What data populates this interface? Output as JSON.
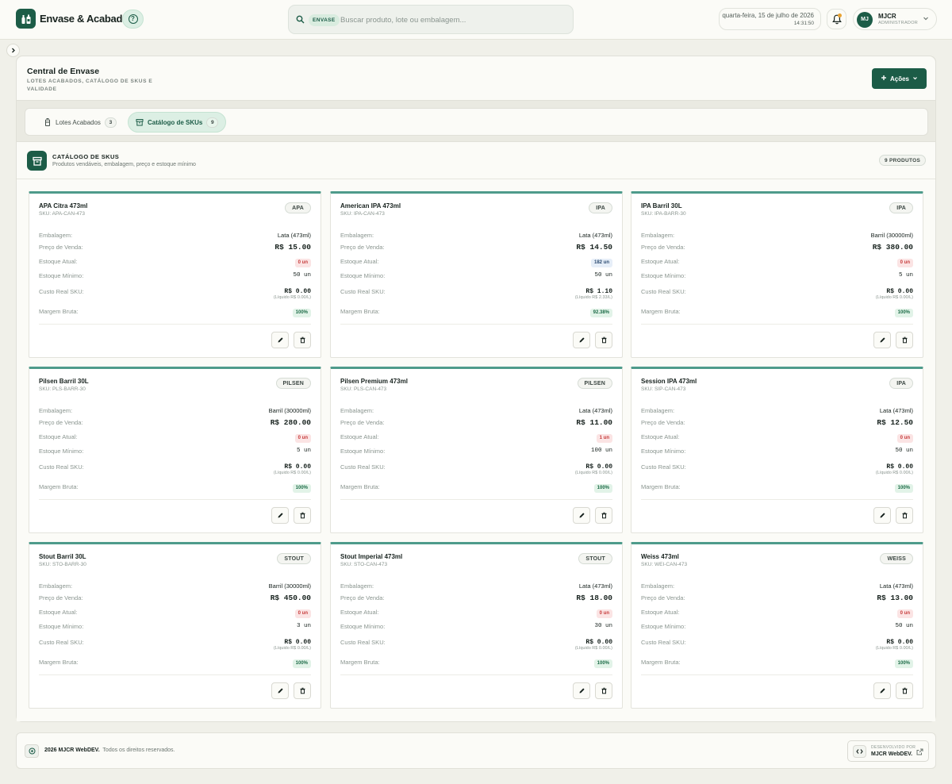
{
  "header": {
    "app_title": "Envase & Acabados",
    "search_chip": "ENVASE",
    "search_placeholder": "Buscar produto, lote ou embalagem...",
    "date": "quarta-feira, 15 de julho de 2026",
    "time": "14:31:50",
    "user_initials": "MJ",
    "user_name": "MJCR",
    "user_role": "ADMINISTRADOR"
  },
  "page": {
    "title": "Central de Envase",
    "subtitle": "LOTES ACABADOS, CATÁLOGO DE SKUS E VALIDADE",
    "actions_label": "Ações"
  },
  "tabs": [
    {
      "label": "Lotes Acabados",
      "count": "3"
    },
    {
      "label": "Catálogo de SKUs",
      "count": "9"
    }
  ],
  "catalog": {
    "title": "CATÁLOGO DE SKUS",
    "subtitle": "Produtos vendáveis, embalagem, preço e estoque mínimo",
    "count_label": "9 PRODUTOS",
    "labels": {
      "packaging": "Embalagem:",
      "price": "Preço de Venda:",
      "stock": "Estoque Atual:",
      "min_stock": "Estoque Mínimo:",
      "cost": "Custo Real SKU:",
      "margin": "Margem Bruta:"
    },
    "products": [
      {
        "name": "APA Citra 473ml",
        "sku": "SKU: APA-CAN-473",
        "style": "APA",
        "packaging": "Lata (473ml)",
        "price": "R$ 15.00",
        "stock": "0 un",
        "stock_status": "red",
        "min_stock": "50 un",
        "cost": "R$ 0.00",
        "cost_note": "(Líquido R$ 0.00/L)",
        "margin": "100%"
      },
      {
        "name": "American IPA 473ml",
        "sku": "SKU: IPA-CAN-473",
        "style": "IPA",
        "packaging": "Lata (473ml)",
        "price": "R$ 14.50",
        "stock": "182 un",
        "stock_status": "blue",
        "min_stock": "50 un",
        "cost": "R$ 1.10",
        "cost_note": "(Líquido R$ 2.33/L)",
        "margin": "92.38%"
      },
      {
        "name": "IPA Barril 30L",
        "sku": "SKU: IPA-BARR-30",
        "style": "IPA",
        "packaging": "Barril (30000ml)",
        "price": "R$ 380.00",
        "stock": "0 un",
        "stock_status": "red",
        "min_stock": "5 un",
        "cost": "R$ 0.00",
        "cost_note": "(Líquido R$ 0.00/L)",
        "margin": "100%"
      },
      {
        "name": "Pilsen Barril 30L",
        "sku": "SKU: PLS-BARR-30",
        "style": "PILSEN",
        "packaging": "Barril (30000ml)",
        "price": "R$ 280.00",
        "stock": "0 un",
        "stock_status": "red",
        "min_stock": "5 un",
        "cost": "R$ 0.00",
        "cost_note": "(Líquido R$ 0.00/L)",
        "margin": "100%"
      },
      {
        "name": "Pilsen Premium 473ml",
        "sku": "SKU: PLS-CAN-473",
        "style": "PILSEN",
        "packaging": "Lata (473ml)",
        "price": "R$ 11.00",
        "stock": "1 un",
        "stock_status": "red",
        "min_stock": "100 un",
        "cost": "R$ 0.00",
        "cost_note": "(Líquido R$ 0.00/L)",
        "margin": "100%"
      },
      {
        "name": "Session IPA 473ml",
        "sku": "SKU: SIP-CAN-473",
        "style": "IPA",
        "packaging": "Lata (473ml)",
        "price": "R$ 12.50",
        "stock": "0 un",
        "stock_status": "red",
        "min_stock": "50 un",
        "cost": "R$ 0.00",
        "cost_note": "(Líquido R$ 0.00/L)",
        "margin": "100%"
      },
      {
        "name": "Stout Barril 30L",
        "sku": "SKU: STO-BARR-30",
        "style": "STOUT",
        "packaging": "Barril (30000ml)",
        "price": "R$ 450.00",
        "stock": "0 un",
        "stock_status": "red",
        "min_stock": "3 un",
        "cost": "R$ 0.00",
        "cost_note": "(Líquido R$ 0.00/L)",
        "margin": "100%"
      },
      {
        "name": "Stout Imperial 473ml",
        "sku": "SKU: STO-CAN-473",
        "style": "STOUT",
        "packaging": "Lata (473ml)",
        "price": "R$ 18.00",
        "stock": "0 un",
        "stock_status": "red",
        "min_stock": "30 un",
        "cost": "R$ 0.00",
        "cost_note": "(Líquido R$ 0.00/L)",
        "margin": "100%"
      },
      {
        "name": "Weiss 473ml",
        "sku": "SKU: WEI-CAN-473",
        "style": "WEISS",
        "packaging": "Lata (473ml)",
        "price": "R$ 13.00",
        "stock": "0 un",
        "stock_status": "red",
        "min_stock": "50 un",
        "cost": "R$ 0.00",
        "cost_note": "(Líquido R$ 0.00/L)",
        "margin": "100%"
      }
    ]
  },
  "footer": {
    "brand": "2026 MJCR WebDEV.",
    "rights": "Todos os direitos reservados.",
    "dev_label": "DESENVOLVIDO POR",
    "dev_name": "MJCR WebDEV."
  },
  "colors": {
    "primary": "#1c5c47",
    "card_top_border": "#4e9b8b",
    "stock_out": "#c63b3b",
    "margin_green": "#1c6b47",
    "notification_dot": "#e8a232"
  }
}
